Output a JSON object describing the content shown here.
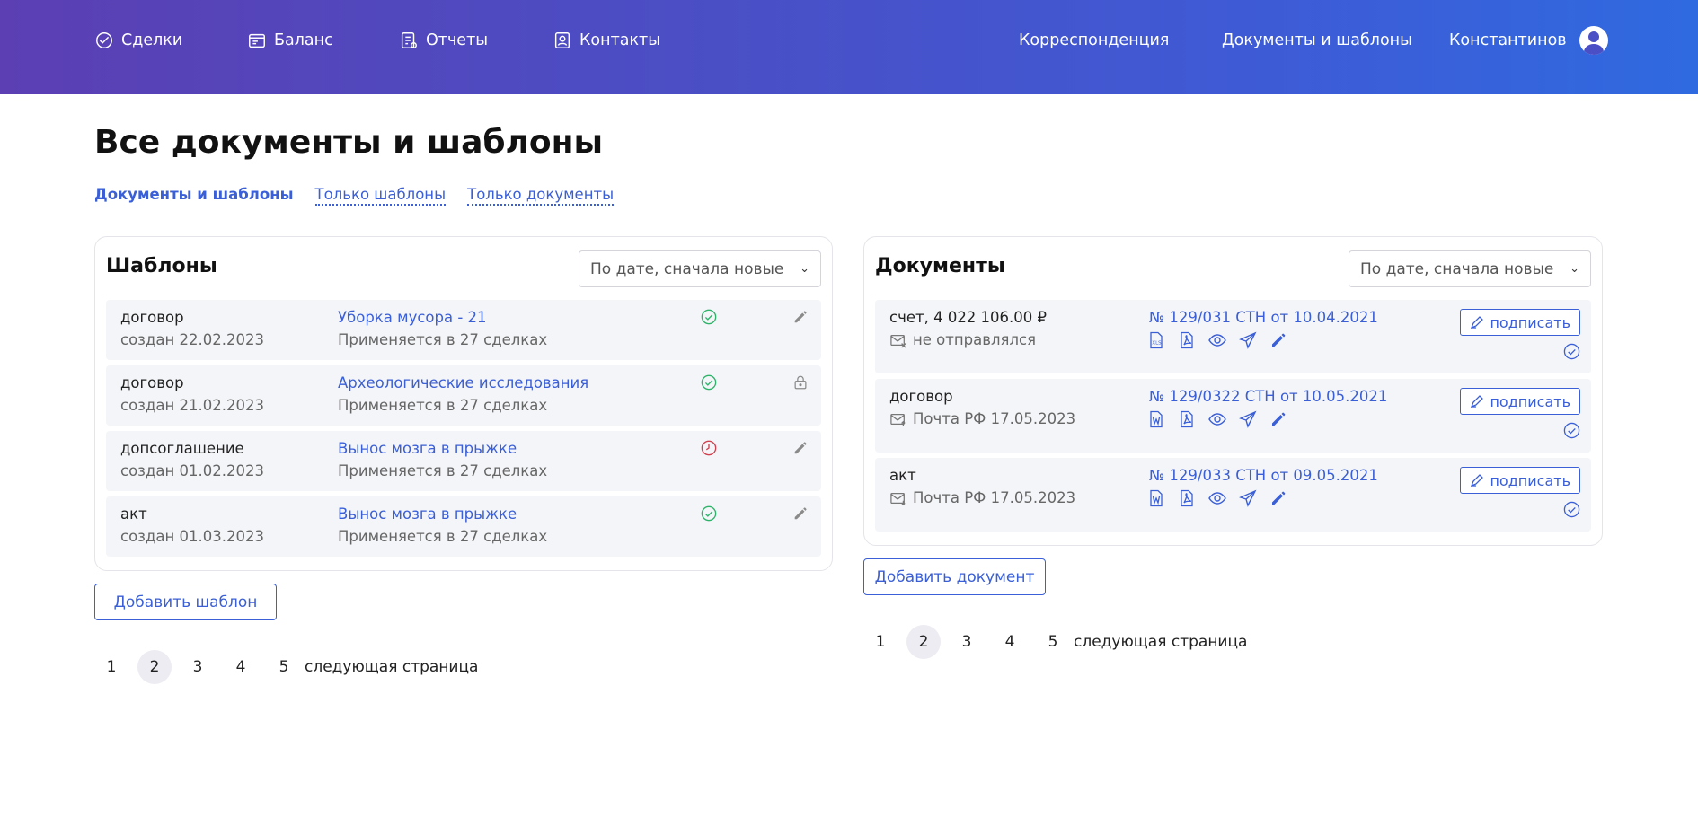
{
  "nav": {
    "deals": "Сделки",
    "balance": "Баланс",
    "reports": "Отчеты",
    "contacts": "Контакты",
    "correspondence": "Корреспонденция",
    "docs_templates": "Документы и шаблоны",
    "user": "Константинов"
  },
  "page": {
    "title": "Все документы и шаблоны"
  },
  "filters": {
    "all": "Документы и шаблоны",
    "templates_only": "Только шаблоны",
    "documents_only": "Только документы"
  },
  "templates": {
    "title": "Шаблоны",
    "sort": "По дате, сначала новые",
    "rows": [
      {
        "type": "договор",
        "created": "создан 22.02.2023",
        "name": "Уборка мусора - 21",
        "usage": "Применяется в 27 сделках",
        "status": "approved",
        "action": "edit"
      },
      {
        "type": "договор",
        "created": "создан 21.02.2023",
        "name": "Археологические исследования",
        "usage": "Применяется в 27 сделках",
        "status": "approved",
        "action": "locked"
      },
      {
        "type": "допсоглашение",
        "created": "создан 01.02.2023",
        "name": "Вынос мозга в прыжке",
        "usage": "Применяется в 27 сделках",
        "status": "pending",
        "action": "edit"
      },
      {
        "type": "акт",
        "created": "создан 01.03.2023",
        "name": "Вынос мозга в прыжке",
        "usage": "Применяется в 27 сделках",
        "status": "approved",
        "action": "edit"
      }
    ],
    "add_button": "Добавить шаблон",
    "pages": [
      "1",
      "2",
      "3",
      "4",
      "5"
    ],
    "current_page": "2",
    "next": "следующая страница"
  },
  "documents": {
    "title": "Документы",
    "sort": "По дате, сначала новые",
    "sign_label": "подписать",
    "rows": [
      {
        "type": "счет, 4 022 106.00 ₽",
        "send": "не отправлялся",
        "number": "№ 129/031 СТН от 10.04.2021",
        "file": "xls"
      },
      {
        "type": "договор",
        "send": "Почта РФ 17.05.2023",
        "number": "№ 129/0322 СТН от 10.05.2021",
        "file": "word"
      },
      {
        "type": "акт",
        "send": "Почта РФ 17.05.2023",
        "number": "№ 129/033 СТН от 09.05.2021",
        "file": "word"
      }
    ],
    "add_button": "Добавить документ",
    "pages": [
      "1",
      "2",
      "3",
      "4",
      "5"
    ],
    "current_page": "2",
    "next": "следующая страница"
  },
  "colors": {
    "accent": "#3a5fd6",
    "approved": "#2fb36b",
    "pending": "#d0404f",
    "muted": "#8a8a8a"
  }
}
